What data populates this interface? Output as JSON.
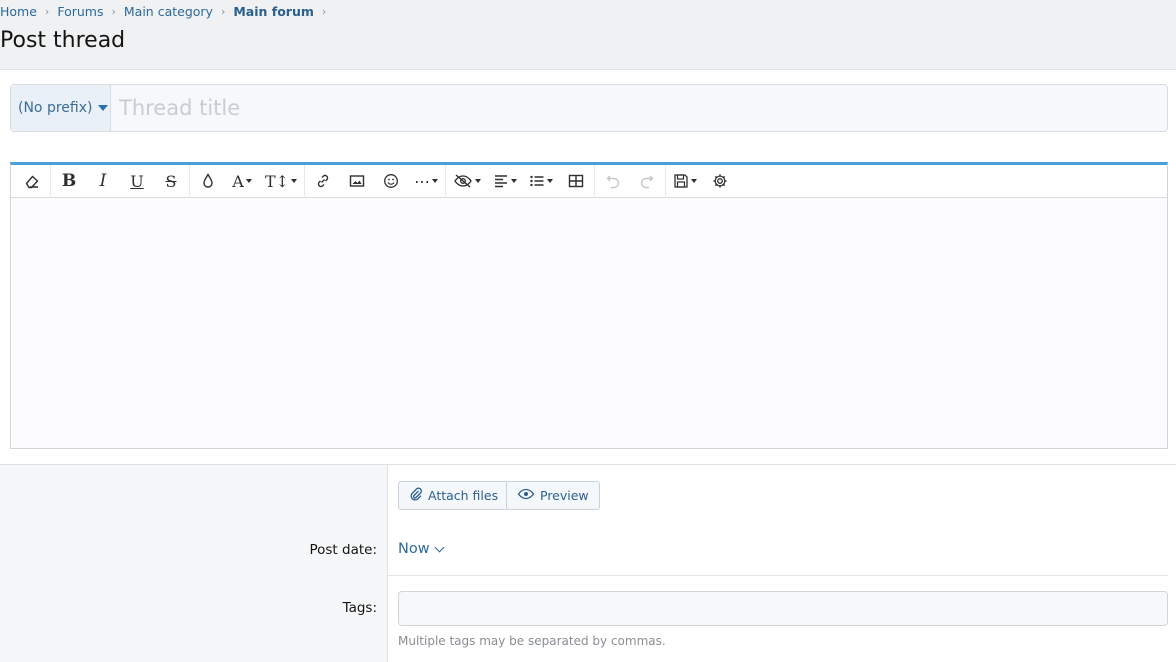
{
  "breadcrumb": {
    "items": [
      "Home",
      "Forums",
      "Main category",
      "Main forum"
    ]
  },
  "page": {
    "title": "Post thread"
  },
  "thread": {
    "prefix_label": "(No prefix)",
    "title_placeholder": "Thread title"
  },
  "toolbar": {
    "buttons": [
      {
        "name": "remove-format",
        "icon": "eraser-icon",
        "glyph": "⌫"
      },
      {
        "name": "bold",
        "icon": "bold-icon",
        "glyph": "B"
      },
      {
        "name": "italic",
        "icon": "italic-icon",
        "glyph": "I"
      },
      {
        "name": "underline",
        "icon": "underline-icon",
        "glyph": "U"
      },
      {
        "name": "strikethrough",
        "icon": "strikethrough-icon",
        "glyph": "S"
      },
      {
        "name": "text-color",
        "icon": "droplet-icon",
        "glyph": "💧"
      },
      {
        "name": "font-family",
        "icon": "font-family-icon",
        "glyph": "A"
      },
      {
        "name": "font-size",
        "icon": "font-size-icon",
        "glyph": "T↕"
      },
      {
        "name": "insert-link",
        "icon": "link-icon",
        "glyph": "🔗"
      },
      {
        "name": "insert-image",
        "icon": "image-icon",
        "glyph": "🖼"
      },
      {
        "name": "insert-emoji",
        "icon": "smiley-icon",
        "glyph": "☺"
      },
      {
        "name": "more-options",
        "icon": "ellipsis-icon",
        "glyph": "⋯"
      },
      {
        "name": "spoiler",
        "icon": "eye-slash-icon",
        "glyph": "⊘"
      },
      {
        "name": "alignment",
        "icon": "align-left-icon",
        "glyph": "☰"
      },
      {
        "name": "list",
        "icon": "list-icon",
        "glyph": "☷"
      },
      {
        "name": "insert-table",
        "icon": "table-icon",
        "glyph": "▦"
      },
      {
        "name": "undo",
        "icon": "undo-icon",
        "glyph": "↶"
      },
      {
        "name": "redo",
        "icon": "redo-icon",
        "glyph": "↷"
      },
      {
        "name": "drafts",
        "icon": "save-icon",
        "glyph": "💾"
      },
      {
        "name": "settings",
        "icon": "gear-icon",
        "glyph": "⚙"
      }
    ]
  },
  "actions": {
    "attach_label": "Attach files",
    "preview_label": "Preview"
  },
  "post_date": {
    "label": "Post date:",
    "value": "Now"
  },
  "tags": {
    "label": "Tags:",
    "hint": "Multiple tags may be separated by commas."
  },
  "colors": {
    "accent": "#4aa1d9",
    "link": "#2b6a9c",
    "band": "#f0f1f2"
  }
}
